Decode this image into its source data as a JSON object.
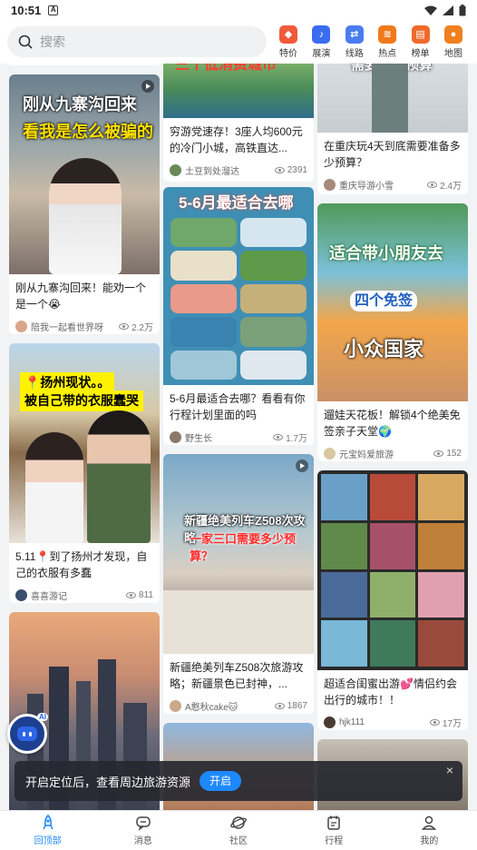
{
  "status_bar": {
    "time": "10:51",
    "sim_label": "A"
  },
  "search": {
    "placeholder": "搜索"
  },
  "quick_nav": [
    {
      "label": "特价",
      "icon": "tag-icon",
      "color": "#f05a3a"
    },
    {
      "label": "展演",
      "icon": "music-icon",
      "color": "#3a6cf0"
    },
    {
      "label": "线路",
      "icon": "route-icon",
      "color": "#4a7cf0"
    },
    {
      "label": "热点",
      "icon": "hot-icon",
      "color": "#f07a1a"
    },
    {
      "label": "榜单",
      "icon": "ranking-icon",
      "color": "#f06a2a"
    },
    {
      "label": "地图",
      "icon": "map-icon",
      "color": "#f08020"
    }
  ],
  "feed": {
    "col1": [
      {
        "image_text": [
          "刚从九寨沟回来",
          "看我是怎么被骗的"
        ],
        "title": "刚从九寨沟回来！能劝一个是一个😭",
        "author": "陪我一起看世界呀",
        "views": "2.2万",
        "video": true
      },
      {
        "image_text": [
          "📍扬州现状。。",
          "被自己带的衣服蠢哭"
        ],
        "title": "5.11📍到了扬州才发现，自己的衣服有多蠢",
        "author": "喜喜游记",
        "views": "811",
        "video": false
      },
      {
        "image_text": [],
        "title": "",
        "author": "",
        "views": "",
        "video": false
      }
    ],
    "col2": [
      {
        "image_text": [
          "三个低消费城市"
        ],
        "title": "穷游党速存！3座人均600元的冷门小城，高铁直达...",
        "author": "土豆到处溜达",
        "views": "2391",
        "video": false
      },
      {
        "image_text": [
          "5-6月最适合去哪"
        ],
        "title": "5-6月最适合去哪？看看有你行程计划里面的吗",
        "author": "野生长",
        "views": "1.7万",
        "video": false
      },
      {
        "image_text": [
          "新疆绝美列车Z508次攻略",
          "一家三口需要多少预算？"
        ],
        "title": "新疆绝美列车Z508次旅游攻略；新疆景色已封神，...",
        "author": "A憨秋cake🐱",
        "views": "1867",
        "video": true
      }
    ],
    "col3": [
      {
        "image_text": [
          "需要多少预算"
        ],
        "title": "在重庆玩4天到底需要准备多少预算？",
        "author": "重庆导游小雪",
        "views": "2.4万",
        "video": false
      },
      {
        "image_text": [
          "适合带小朋友去",
          "四个免签",
          "小众国家"
        ],
        "title": "遛娃天花板！解锁4个绝美免签亲子天堂🌍",
        "author": "元宝妈爱旅游",
        "views": "152",
        "video": false
      },
      {
        "image_text": [],
        "title": "超适合闺蜜出游💕情侣约会出行的城市！！",
        "author": "hjk111",
        "views": "17万",
        "video": false
      }
    ]
  },
  "ai_assistant": {
    "badge": "AI"
  },
  "location_toast": {
    "message": "开启定位后，查看周边旅游资源",
    "button": "开启",
    "close": "×"
  },
  "tab_bar": [
    {
      "label": "回顶部",
      "icon": "rocket-icon",
      "active": true
    },
    {
      "label": "消息",
      "icon": "message-icon",
      "active": false
    },
    {
      "label": "社区",
      "icon": "planet-icon",
      "active": false
    },
    {
      "label": "行程",
      "icon": "calendar-icon",
      "active": false
    },
    {
      "label": "我的",
      "icon": "profile-icon",
      "active": false
    }
  ]
}
